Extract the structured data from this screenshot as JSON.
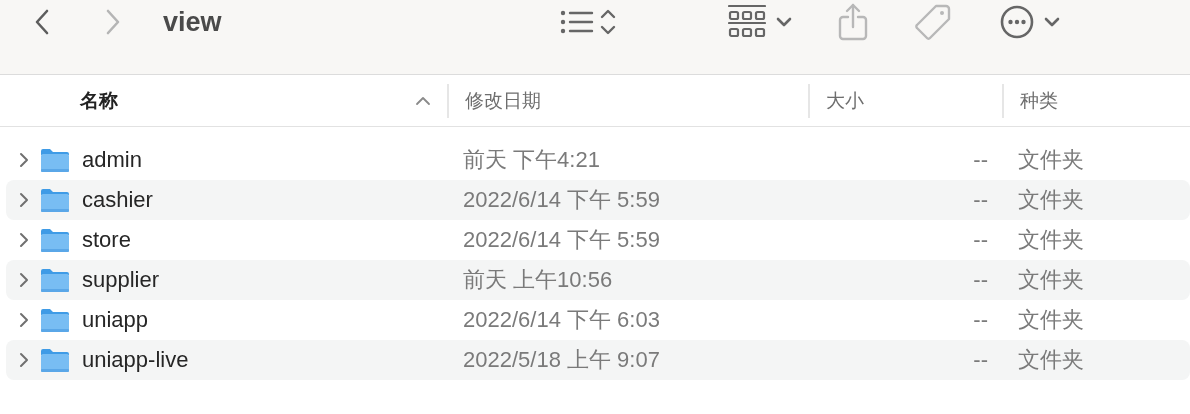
{
  "toolbar": {
    "back": {
      "disabled": false
    },
    "forward": {
      "disabled": true
    },
    "title": "view"
  },
  "columns": [
    {
      "label": "名称",
      "selected": true
    },
    {
      "label": "修改日期",
      "selected": false
    },
    {
      "label": "大小",
      "selected": false
    },
    {
      "label": "种类",
      "selected": false
    }
  ],
  "rows": [
    {
      "name": "admin",
      "date": "前天 下午4:21",
      "size": "--",
      "kind": "文件夹",
      "expanded": false
    },
    {
      "name": "cashier",
      "date": "2022/6/14 下午 5:59",
      "size": "--",
      "kind": "文件夹",
      "expanded": false
    },
    {
      "name": "store",
      "date": "2022/6/14 下午 5:59",
      "size": "--",
      "kind": "文件夹",
      "expanded": false
    },
    {
      "name": "supplier",
      "date": "前天 上午10:56",
      "size": "--",
      "kind": "文件夹",
      "expanded": false
    },
    {
      "name": "uniapp",
      "date": "2022/6/14 下午 6:03",
      "size": "--",
      "kind": "文件夹",
      "expanded": false
    },
    {
      "name": "uniapp-live",
      "date": "2022/5/18 上午 9:07",
      "size": "--",
      "kind": "文件夹",
      "expanded": false
    }
  ]
}
